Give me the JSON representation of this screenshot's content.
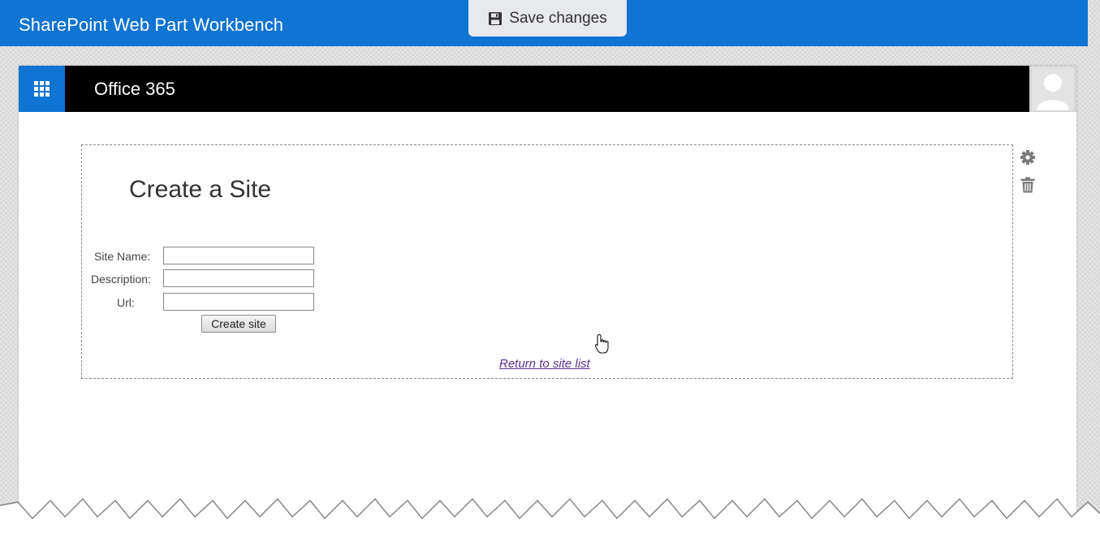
{
  "workbench": {
    "title": "SharePoint Web Part Workbench",
    "save_button": {
      "label": "Save changes",
      "icon": "save-icon"
    }
  },
  "suite_bar": {
    "app_launcher_icon": "waffle-icon",
    "title": "Office 365",
    "avatar_icon": "user-icon"
  },
  "webpart": {
    "title": "Create a Site",
    "form": {
      "site_name_label": "Site Name:",
      "site_name_value": "",
      "description_label": "Description:",
      "description_value": "",
      "url_label": "Url:",
      "url_value": "",
      "create_button_label": "Create site"
    },
    "return_link": "Return to site list",
    "toolbar": {
      "settings_icon": "gear-icon",
      "delete_icon": "trash-icon"
    }
  },
  "colors": {
    "brand_blue": "#0f74d2",
    "suite_bar": "#000000",
    "link_visited": "#5b2d91"
  }
}
